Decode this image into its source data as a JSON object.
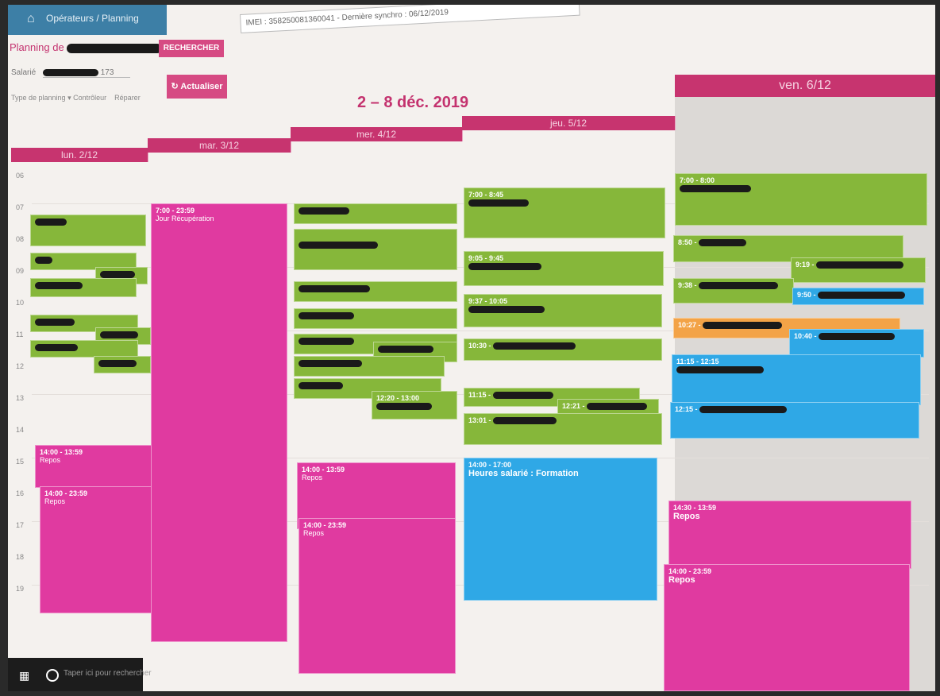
{
  "app": {
    "nav_home_icon": "home-icon",
    "breadcrumb": "Opérateurs / Planning",
    "planning_label": "Planning de",
    "search_button": "RECHERCHER",
    "device_info": "IMEI : 358250081360041 - Dernière synchro : 06/12/2019",
    "salarie_label": "Salarié",
    "salarie_suffix": "173",
    "type_planning": "Type de planning",
    "option_1": "Contrôleur",
    "option_2": "Réparer",
    "refresh_button": "Actualiser",
    "refresh_icon": "refresh-icon"
  },
  "calendar": {
    "week_title": "2 – 8 déc. 2019",
    "days": [
      {
        "label": "lun. 2/12"
      },
      {
        "label": "mar. 3/12"
      },
      {
        "label": "mer. 4/12"
      },
      {
        "label": "jeu. 5/12"
      },
      {
        "label": "ven. 6/12"
      }
    ],
    "hours": [
      "06",
      "07",
      "08",
      "09",
      "10",
      "11",
      "12",
      "13",
      "14",
      "15",
      "16",
      "17",
      "18",
      "19"
    ]
  },
  "events": {
    "mon": [
      {
        "time": "14:00 - 13:59",
        "title": "Repos",
        "color": "pink"
      },
      {
        "time": "14:00 - 23:59",
        "title": "Repos",
        "color": "pink"
      }
    ],
    "tue": [
      {
        "time": "7:00 - 23:59",
        "title": "Jour Récupération",
        "color": "pink"
      }
    ],
    "wed": [
      {
        "time": "14:00 - 13:59",
        "title": "Repos",
        "color": "pink"
      },
      {
        "time": "14:00 - 23:59",
        "title": "Repos",
        "color": "pink"
      },
      {
        "time": "12:20 - 13:00",
        "title": "",
        "color": "green"
      }
    ],
    "thu": [
      {
        "time": "7:00 - 8:45",
        "title": "",
        "color": "green"
      },
      {
        "time": "9:05 - 9:45",
        "title": "",
        "color": "green"
      },
      {
        "time": "9:37 - 10:05",
        "title": "",
        "color": "green"
      },
      {
        "time": "10:30 -",
        "title": "",
        "color": "green"
      },
      {
        "time": "11:15 -",
        "title": "",
        "color": "green"
      },
      {
        "time": "12:21 -",
        "title": "",
        "color": "green"
      },
      {
        "time": "13:01 -",
        "title": "",
        "color": "green"
      },
      {
        "time": "14:00 - 17:00",
        "title": "Heures salarié : Formation",
        "color": "blue"
      }
    ],
    "fri": [
      {
        "time": "7:00 - 8:00",
        "title": "",
        "color": "green"
      },
      {
        "time": "8:50 -",
        "title": "",
        "color": "green"
      },
      {
        "time": "9:19 -",
        "title": "",
        "color": "green"
      },
      {
        "time": "9:38 -",
        "title": "",
        "color": "green"
      },
      {
        "time": "9:50 -",
        "title": "",
        "color": "blue"
      },
      {
        "time": "10:27 -",
        "title": "",
        "color": "orange"
      },
      {
        "time": "10:40 -",
        "title": "",
        "color": "blue"
      },
      {
        "time": "11:15 - 12:15",
        "title": "",
        "color": "blue"
      },
      {
        "time": "12:15 -",
        "title": "",
        "color": "blue"
      },
      {
        "time": "14:30 - 13:59",
        "title": "Repos",
        "color": "pink"
      },
      {
        "time": "14:00 - 23:59",
        "title": "Repos",
        "color": "pink"
      }
    ]
  },
  "taskbar": {
    "start_icon": "windows-start-icon",
    "search_icon": "cortana-search-icon",
    "search_placeholder": "Taper ici pour rechercher"
  },
  "colors": {
    "accent": "#c7346f",
    "green_event": "#86b73a",
    "pink_event": "#e03aa0",
    "blue_event": "#2fa8e6",
    "orange_event": "#f3a347"
  }
}
